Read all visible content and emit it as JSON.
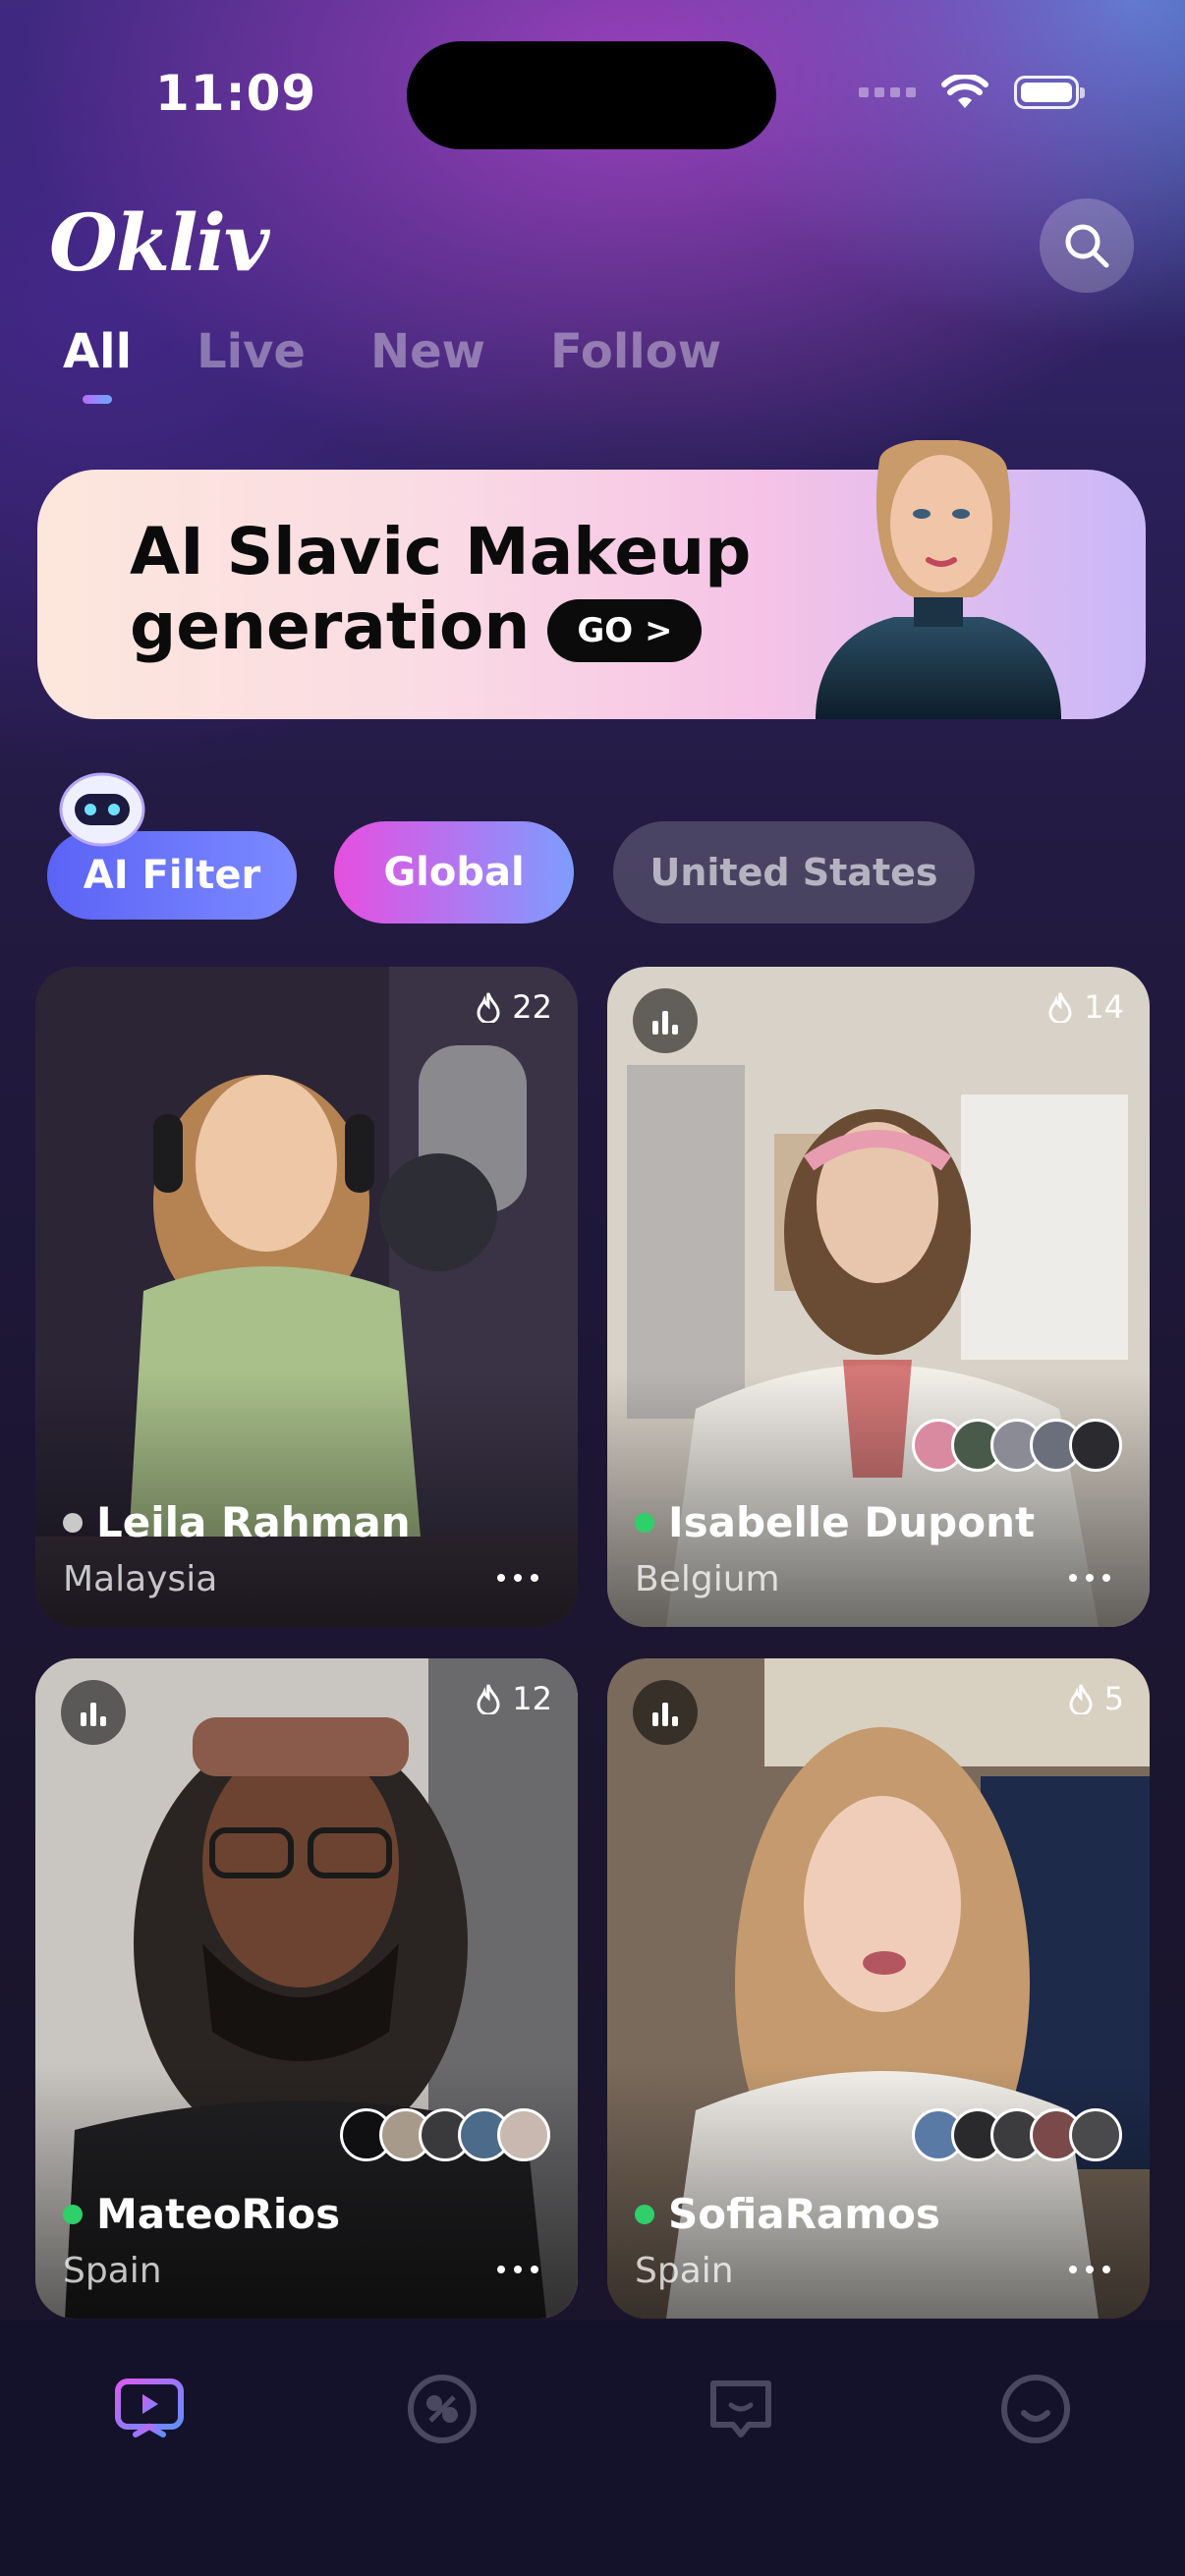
{
  "status": {
    "time": "11:09"
  },
  "app": {
    "logo": "Okliv"
  },
  "header": {
    "search_icon": "search-icon"
  },
  "tabs": [
    {
      "label": "All",
      "active": true
    },
    {
      "label": "Live",
      "active": false
    },
    {
      "label": "New",
      "active": false
    },
    {
      "label": "Follow",
      "active": false
    }
  ],
  "banner": {
    "line1": "AI Slavic Makeup",
    "line2": "generation",
    "cta": "GO >"
  },
  "filters": {
    "ai_filter": "AI Filter",
    "global": "Global",
    "country": "United States"
  },
  "cards": [
    {
      "name": "Leila Rahman",
      "country": "Malaysia",
      "viewers": "22",
      "status_color": "#c9c9c9"
    },
    {
      "name": "Isabelle Dupont",
      "country": "Belgium",
      "viewers": "14",
      "status_color": "#2fcf6a"
    },
    {
      "name": "MateoRios",
      "country": "Spain",
      "viewers": "12",
      "status_color": "#2fcf6a"
    },
    {
      "name": "SofiaRamos",
      "country": "Spain",
      "viewers": "5",
      "status_color": "#2fcf6a"
    }
  ],
  "nav": [
    {
      "icon": "live-tv-icon",
      "active": true
    },
    {
      "icon": "match-icon",
      "active": false
    },
    {
      "icon": "chat-icon",
      "active": false
    },
    {
      "icon": "profile-icon",
      "active": false
    }
  ]
}
